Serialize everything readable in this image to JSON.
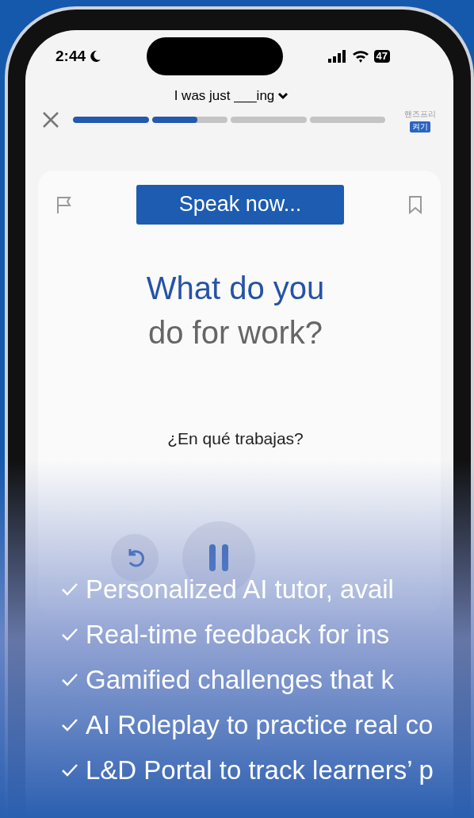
{
  "status_bar": {
    "time": "2:44",
    "battery": "47"
  },
  "header": {
    "prompt": "I was just ___ing",
    "progress": [
      {
        "level": 1
      },
      {
        "level": 0.6
      },
      {
        "level": 0
      },
      {
        "level": 0
      }
    ],
    "handsfree_label": "핸즈프리",
    "handsfree_button": "켜기"
  },
  "card": {
    "speak_button": "Speak now...",
    "question_line_1": "What do you",
    "question_line_2": "do for work?",
    "translation": "¿En qué trabajas?"
  },
  "features": [
    "Personalized AI tutor, avail",
    "Real-time feedback for ins",
    "Gamified challenges that k",
    "AI Roleplay to practice real co",
    "L&D Portal to track learners’ p"
  ]
}
